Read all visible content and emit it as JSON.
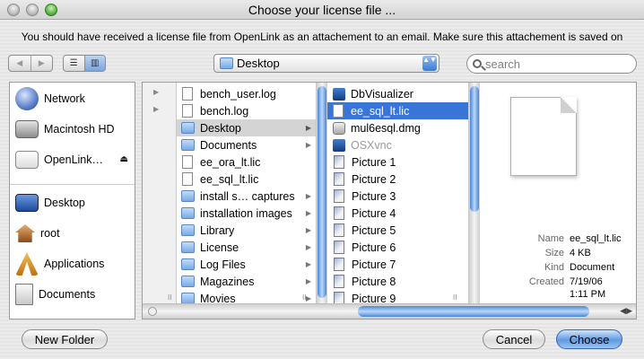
{
  "window": {
    "title": "Choose your license file ...",
    "message": "You should have received a license file from OpenLink as an attachement to an email. Make sure this attachement is saved on"
  },
  "toolbar": {
    "back_glyph": "◀",
    "forward_glyph": "▶",
    "list_view_glyph": "☰",
    "column_view_glyph": "▥",
    "location": "Desktop",
    "location_arrows": "▲▼",
    "search_placeholder": "search"
  },
  "sidebar": {
    "devices": [
      {
        "label": "Network",
        "icon": "network-globe-icon"
      },
      {
        "label": "Macintosh HD",
        "icon": "hard-drive-icon"
      },
      {
        "label": "OpenLink…",
        "icon": "disk-image-icon",
        "eject": "⏏"
      }
    ],
    "places": [
      {
        "label": "Desktop",
        "icon": "desktop-icon"
      },
      {
        "label": "root",
        "icon": "home-icon"
      },
      {
        "label": "Applications",
        "icon": "applications-icon"
      },
      {
        "label": "Documents",
        "icon": "documents-icon"
      }
    ]
  },
  "browser": {
    "column1": [
      {
        "label": "bench_user.log",
        "type": "file"
      },
      {
        "label": "bench.log",
        "type": "file"
      },
      {
        "label": "Desktop",
        "type": "folder",
        "selected": true,
        "arrow": "▶"
      },
      {
        "label": "Documents",
        "type": "folder",
        "arrow": "▶"
      },
      {
        "label": "ee_ora_lt.lic",
        "type": "file"
      },
      {
        "label": "ee_sql_lt.lic",
        "type": "file"
      },
      {
        "label": "install s… captures",
        "type": "folder",
        "arrow": "▶"
      },
      {
        "label": "installation images",
        "type": "folder",
        "arrow": "▶"
      },
      {
        "label": "Library",
        "type": "folder",
        "arrow": "▶"
      },
      {
        "label": "License",
        "type": "folder",
        "arrow": "▶"
      },
      {
        "label": "Log Files",
        "type": "folder",
        "arrow": "▶"
      },
      {
        "label": "Magazines",
        "type": "folder",
        "arrow": "▶"
      },
      {
        "label": "Movies",
        "type": "folder",
        "arrow": "▶"
      }
    ],
    "column2": [
      {
        "label": "DbVisualizer",
        "type": "app"
      },
      {
        "label": "ee_sql_lt.lic",
        "type": "file",
        "selected": true
      },
      {
        "label": "mul6esql.dmg",
        "type": "dmg"
      },
      {
        "label": "OSXvnc",
        "type": "app",
        "disabled": true
      },
      {
        "label": "Picture 1",
        "type": "picture"
      },
      {
        "label": "Picture 2",
        "type": "picture"
      },
      {
        "label": "Picture 3",
        "type": "picture"
      },
      {
        "label": "Picture 4",
        "type": "picture"
      },
      {
        "label": "Picture 5",
        "type": "picture"
      },
      {
        "label": "Picture 6",
        "type": "picture"
      },
      {
        "label": "Picture 7",
        "type": "picture"
      },
      {
        "label": "Picture 8",
        "type": "picture"
      },
      {
        "label": "Picture 9",
        "type": "picture"
      }
    ],
    "column_handle": "II",
    "scroll_arrows": "◀▶"
  },
  "preview": {
    "fields": [
      {
        "key": "Name",
        "value": "ee_sql_lt.lic"
      },
      {
        "key": "Size",
        "value": "4 KB"
      },
      {
        "key": "Kind",
        "value": "Document"
      },
      {
        "key": "Created",
        "value": "7/19/06"
      },
      {
        "key": "",
        "value": "1:11 PM"
      }
    ]
  },
  "buttons": {
    "new_folder": "New Folder",
    "cancel": "Cancel",
    "choose": "Choose"
  }
}
